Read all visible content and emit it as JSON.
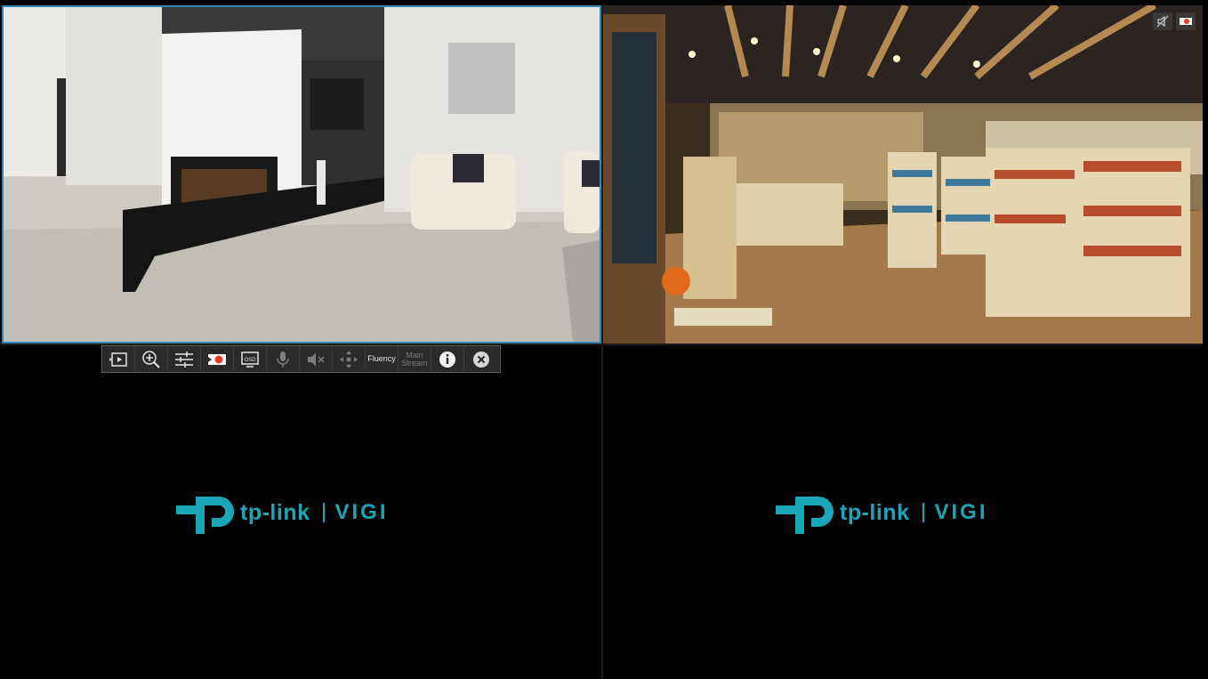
{
  "toolbar": {
    "items": [
      {
        "icon": "playback-icon"
      },
      {
        "icon": "zoom-in-icon"
      },
      {
        "icon": "image-settings-icon"
      },
      {
        "icon": "record-icon"
      },
      {
        "icon": "osd-icon",
        "label": "OSD"
      },
      {
        "icon": "microphone-icon"
      },
      {
        "icon": "mute-icon"
      },
      {
        "icon": "ptz-icon"
      },
      {
        "label": "Fluency"
      },
      {
        "label_line1": "Main",
        "label_line2": "Stream"
      },
      {
        "icon": "info-icon"
      },
      {
        "icon": "close-icon"
      }
    ]
  },
  "tiles": {
    "top_left": {
      "feed": "living-room-camera-feed"
    },
    "top_right": {
      "feed": "store-camera-feed"
    },
    "bottom_left": {
      "logo": {
        "brand": "tp-link",
        "product": "VIGI"
      }
    },
    "bottom_right": {
      "logo": {
        "brand": "tp-link",
        "product": "VIGI"
      }
    }
  },
  "colors": {
    "accent": "#1aa6b7",
    "selected_border": "#2f86b8"
  }
}
